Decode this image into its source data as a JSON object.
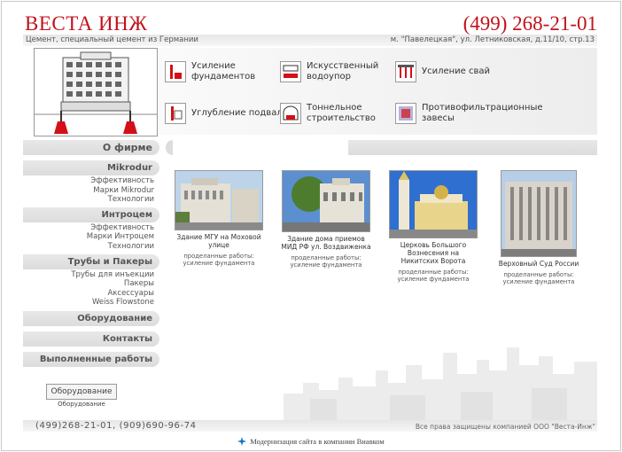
{
  "header": {
    "logo": "ВЕСТА ИНЖ",
    "phone": "(499) 268-21-01",
    "tagline": "Цемент, специальный цемент из Германии",
    "address": "м. \"Павелецкая\", ул. Летниковская, д.11/10, стр.13"
  },
  "services": [
    {
      "label_1": "Усиление",
      "label_2": "фундаментов",
      "icon": "foundation-reinforcement-icon"
    },
    {
      "label_1": "Искусственный",
      "label_2": "водоупор",
      "icon": "artificial-aquiclude-icon"
    },
    {
      "label_1": "Усиление свай",
      "label_2": "",
      "icon": "pile-reinforcement-icon"
    },
    {
      "label_1": "Углубление подвалов",
      "label_2": "",
      "icon": "basement-deepening-icon"
    },
    {
      "label_1": "Тоннельное",
      "label_2": "строительство",
      "icon": "tunnel-construction-icon"
    },
    {
      "label_1": "Противофильтрационные",
      "label_2": "завесы",
      "icon": "anti-filtration-curtain-icon"
    }
  ],
  "nav": {
    "about": "О фирме",
    "mikrodur": "Mikrodur",
    "mikrodur_items": [
      "Эффективность",
      "Марки Mikrodur",
      "Технологии"
    ],
    "intrazem": "Интроцем",
    "intrazem_items": [
      "Эффективность",
      "Марки Интроцем",
      "Технологии"
    ],
    "pipes": "Трубы и Пакеры",
    "pipes_items": [
      "Трубы для инъекции",
      "Пакеры",
      "Аксессуары",
      "Weiss Flowstone"
    ],
    "equipment": "Оборудование",
    "contacts": "Контакты",
    "works": "Выполненные работы"
  },
  "equipment_widget": {
    "alt": "Оборудование",
    "caption": "Оборудование"
  },
  "projects": [
    {
      "title": "Здание МГУ на Моховой улице",
      "meta_1": "проделанные работы:",
      "meta_2": "усиление фундамента"
    },
    {
      "title": "Здание дома приемов МИД РФ ул. Воздвиженка",
      "meta_1": "проделанные работы:",
      "meta_2": "усиление фундамента"
    },
    {
      "title": "Церковь Большого Вознесения на Никитских Ворота",
      "meta_1": "проделанные работы:",
      "meta_2": "усиление фундамента"
    },
    {
      "title": "Верховный Суд России",
      "meta_1": "проделанные работы:",
      "meta_2": "усиление фундамента"
    }
  ],
  "footer": {
    "phones": "(499)268-21-01, (909)690-96-74",
    "copyright": "Все права защищены компанией ООО \"Веста-Инж\"",
    "credit": "Модернизация сайта в компании Виавком"
  },
  "colors": {
    "brand_red": "#c1121c",
    "bar_gray": "#e0e0e0"
  }
}
